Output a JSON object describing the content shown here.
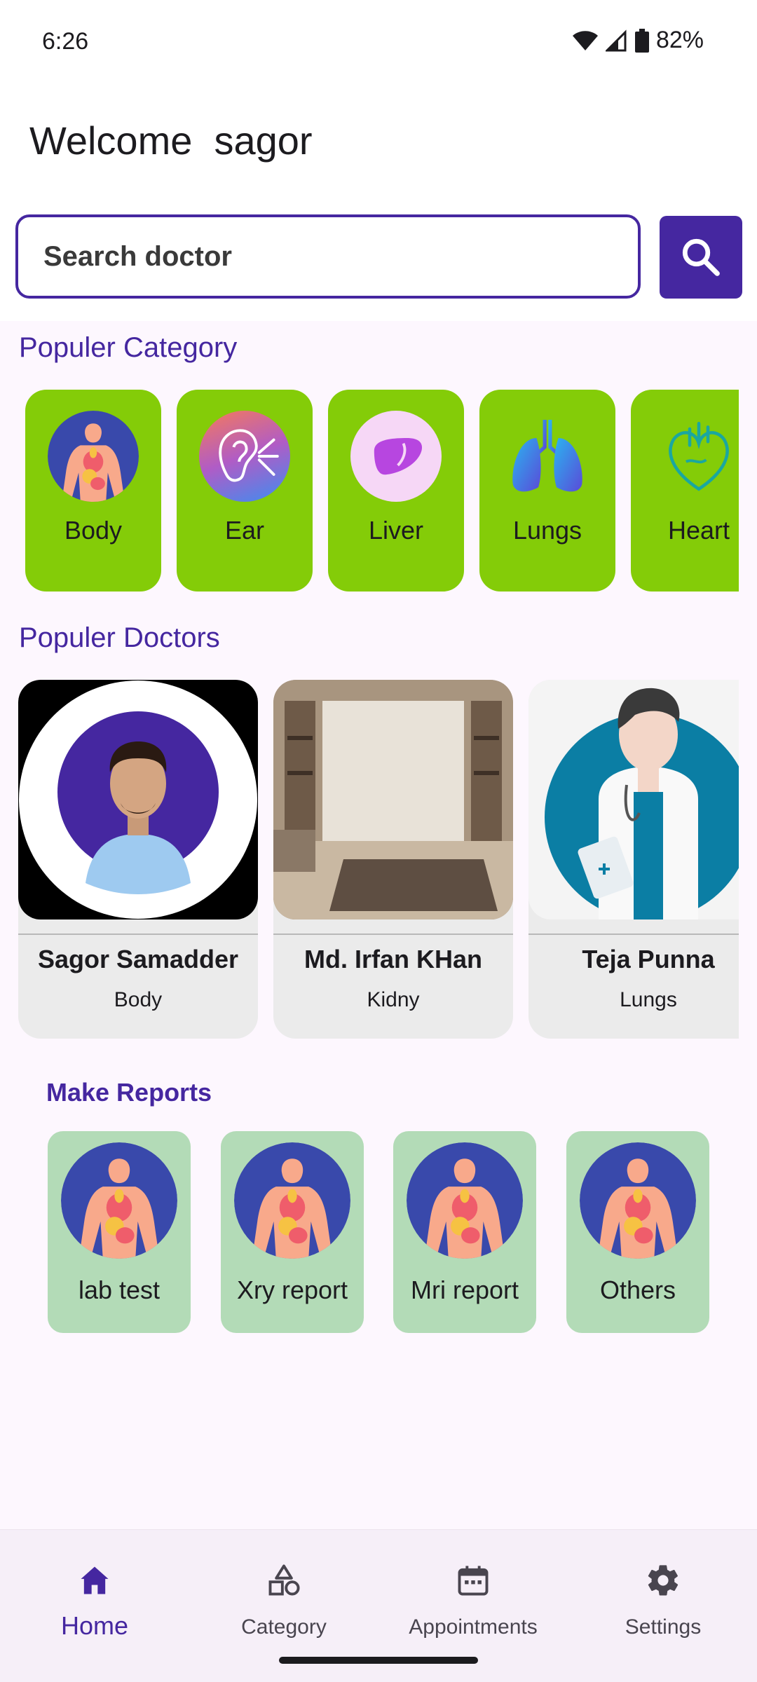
{
  "status": {
    "time": "6:26",
    "battery": "82%"
  },
  "header": {
    "welcome": "Welcome  sagor"
  },
  "search": {
    "placeholder": "Search doctor",
    "value": ""
  },
  "categories": {
    "title": "Populer Category",
    "items": [
      {
        "label": "Body",
        "icon": "body-icon"
      },
      {
        "label": "Ear",
        "icon": "ear-icon"
      },
      {
        "label": "Liver",
        "icon": "liver-icon"
      },
      {
        "label": "Lungs",
        "icon": "lungs-icon"
      },
      {
        "label": "Heart",
        "icon": "heart-icon"
      }
    ]
  },
  "doctors": {
    "title": "Populer Doctors",
    "items": [
      {
        "name": "Sagor Samadder",
        "specialty": "Body"
      },
      {
        "name": "Md. Irfan KHan",
        "specialty": "Kidny"
      },
      {
        "name": "Teja Punna",
        "specialty": "Lungs"
      }
    ]
  },
  "reports": {
    "title": "Make Reports",
    "items": [
      {
        "label": "lab test"
      },
      {
        "label": "Xry report"
      },
      {
        "label": "Mri report"
      },
      {
        "label": "Others"
      }
    ]
  },
  "nav": {
    "items": [
      {
        "label": "Home",
        "icon": "home-icon",
        "active": true
      },
      {
        "label": "Category",
        "icon": "shapes-icon",
        "active": false
      },
      {
        "label": "Appointments",
        "icon": "calendar-icon",
        "active": false
      },
      {
        "label": "Settings",
        "icon": "gear-icon",
        "active": false
      }
    ]
  },
  "colors": {
    "accent": "#4527a0",
    "category_card": "#84cc08",
    "report_card": "#b3dbb7",
    "doctor_card": "#ebebeb",
    "background": "#fdf7fe"
  }
}
